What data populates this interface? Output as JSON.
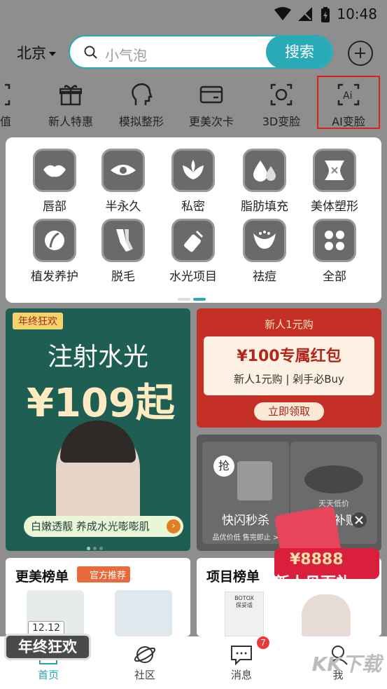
{
  "status": {
    "time": "10:48"
  },
  "header": {
    "city": "北京",
    "search_placeholder": "小气泡",
    "search_button": "搜索"
  },
  "quick_nav": [
    {
      "label": "颜值",
      "icon": "face-scan-icon"
    },
    {
      "label": "新人特惠",
      "icon": "gift-icon"
    },
    {
      "label": "模拟整形",
      "icon": "face-profile-icon"
    },
    {
      "label": "更美次卡",
      "icon": "card-icon"
    },
    {
      "label": "3D变脸",
      "icon": "face-3d-icon"
    },
    {
      "label": "AI变脸",
      "icon": "ai-face-icon"
    }
  ],
  "categories": [
    {
      "label": "唇部",
      "icon": "lips-icon"
    },
    {
      "label": "半永久",
      "icon": "eye-icon"
    },
    {
      "label": "私密",
      "icon": "flower-icon"
    },
    {
      "label": "脂肪填充",
      "icon": "drops-icon"
    },
    {
      "label": "美体塑形",
      "icon": "body-icon"
    },
    {
      "label": "植发养护",
      "icon": "hair-icon"
    },
    {
      "label": "脱毛",
      "icon": "legs-icon"
    },
    {
      "label": "水光项目",
      "icon": "syringe-icon"
    },
    {
      "label": "祛痘",
      "icon": "acne-icon"
    },
    {
      "label": "全部",
      "icon": "grid-icon"
    }
  ],
  "banners": {
    "left": {
      "tag": "年终狂欢",
      "title": "注射水光",
      "price": "¥109起",
      "slogan": "白嫩透靓 养成水光嘭嘭肌"
    },
    "red": {
      "top": "新人1元购",
      "big": "¥100专属红包",
      "sub": "新人1元购 | 剁手必Buy",
      "button": "立即领取"
    },
    "flash": {
      "left_name": "快闪秒杀",
      "left_tiny": "品优价低 售完即止 >",
      "right_name": "官方补贴",
      "right_tag": "天天低价",
      "grab": "抢"
    },
    "gift": {
      "amount": "¥8888",
      "text": "新人见面礼"
    }
  },
  "ranks": {
    "left_title": "更美榜单",
    "left_tag": "官方推荐",
    "right_title": "项目榜单",
    "right_brand": "BOTOX",
    "right_brand_cn": "保妥适"
  },
  "float_badge": {
    "date": "12.12",
    "text": "年终狂欢"
  },
  "bottom_nav": [
    {
      "label": "首页",
      "icon": "home-icon"
    },
    {
      "label": "社区",
      "icon": "planet-icon"
    },
    {
      "label": "消息",
      "icon": "chat-icon",
      "badge": "7"
    },
    {
      "label": "我",
      "icon": "profile-icon"
    }
  ],
  "watermark": "KK下载",
  "colors": {
    "accent": "#2aa9b6",
    "highlight": "#d9221d",
    "red": "#c53026"
  }
}
